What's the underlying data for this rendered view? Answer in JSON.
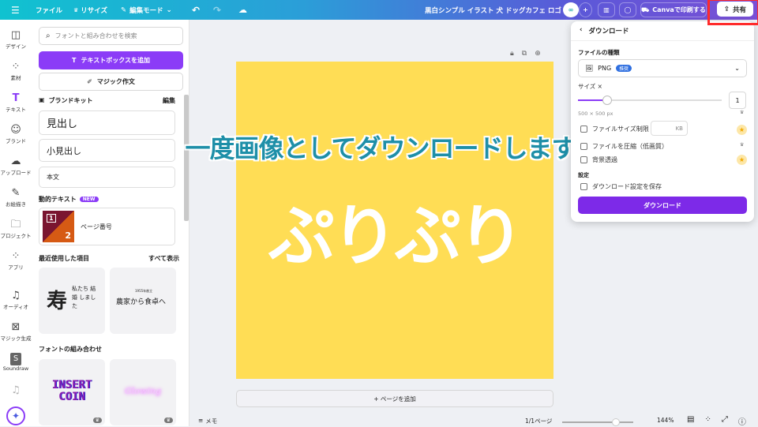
{
  "topbar": {
    "menu_icon": "hamburger-icon",
    "file": "ファイル",
    "resize": "リサイズ",
    "edit_mode": "編集モード",
    "doc_title": "黒白シンプル イラスト 犬 ドッグカフェ ロゴ",
    "print": "Canvaで印刷する",
    "share": "共有"
  },
  "rail": [
    {
      "label": "デザイン",
      "icon": "layout-icon"
    },
    {
      "label": "素材",
      "icon": "elements-icon"
    },
    {
      "label": "テキスト",
      "icon": "text-icon"
    },
    {
      "label": "ブランド",
      "icon": "brand-icon"
    },
    {
      "label": "アップロード",
      "icon": "upload-icon"
    },
    {
      "label": "お絵描き",
      "icon": "draw-icon"
    },
    {
      "label": "プロジェクト",
      "icon": "folder-icon"
    },
    {
      "label": "アプリ",
      "icon": "apps-icon"
    },
    {
      "label": "オーディオ",
      "icon": "audio-icon"
    },
    {
      "label": "マジック生成",
      "icon": "magic-icon"
    },
    {
      "label": "Soundraw",
      "icon": "soundraw-icon"
    }
  ],
  "panel": {
    "search_placeholder": "フォントと組み合わせを検索",
    "add_textbox": "テキストボックスを追加",
    "magic_write": "マジック作文",
    "brand_kit": "ブランドキット",
    "edit": "編集",
    "heading": "見出し",
    "subheading": "小見出し",
    "body": "本文",
    "dynamic_text": "動的テキスト",
    "new_badge": "NEW",
    "page_number": "ページ番号",
    "recent": "最近使用した項目",
    "show_all": "すべて表示",
    "recent_items": [
      {
        "big": "寿",
        "lines": "私たち 結婚 しました"
      },
      {
        "small": "1955年創立",
        "big": "農家から食卓へ"
      }
    ],
    "font_combos": "フォントの組み合わせ",
    "combo_items": [
      "INSERT COIN",
      "Glowing"
    ]
  },
  "canvas": {
    "page_color": "#FFDD55",
    "main_text": "ぷりぷり",
    "overlay_caption": "一度画像としてダウンロードします",
    "add_page": "+ ページを追加"
  },
  "bottom": {
    "notes": "メモ",
    "page_indicator": "1/1ページ",
    "zoom": "144%",
    "zoom_level_percent": 144
  },
  "download": {
    "back": "ダウンロード",
    "file_type_label": "ファイルの種類",
    "file_type": "PNG",
    "recommended": "推奨",
    "size_label": "サイズ ×",
    "size_value": "1",
    "dimensions": "500 × 500 px",
    "limit_size": "ファイルサイズ制限",
    "kb": "KB",
    "compress": "ファイルを圧縮（低画質）",
    "transparent": "背景透過",
    "settings": "設定",
    "save_settings": "ダウンロード設定を保存",
    "download_button": "ダウンロード",
    "accent": "#7D2AE8"
  }
}
